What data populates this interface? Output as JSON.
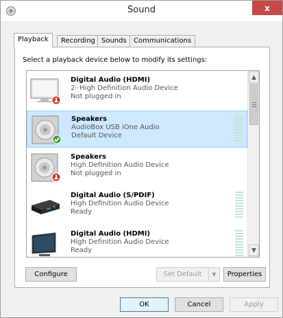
{
  "window": {
    "title": "Sound",
    "close_label": "x",
    "icon": "speaker-icon"
  },
  "tabs": [
    {
      "label": "Playback",
      "active": true
    },
    {
      "label": "Recording",
      "active": false
    },
    {
      "label": "Sounds",
      "active": false
    },
    {
      "label": "Communications",
      "active": false
    }
  ],
  "panel": {
    "instruction": "Select a playback device below to modify its settings:"
  },
  "devices": [
    {
      "name": "Digital Audio (HDMI)",
      "description": "2- High Definition Audio Device",
      "status": "Not plugged in",
      "icon": "monitor-icon",
      "badge": "unplugged-badge-icon",
      "selected": false,
      "level_meter": false
    },
    {
      "name": "Speakers",
      "description": "AudioBox USB iOne Audio",
      "status": "Default Device",
      "icon": "speaker-icon",
      "badge": "default-check-badge-icon",
      "selected": true,
      "level_meter": true
    },
    {
      "name": "Speakers",
      "description": "High Definition Audio Device",
      "status": "Not plugged in",
      "icon": "speaker-icon",
      "badge": "unplugged-badge-icon",
      "selected": false,
      "level_meter": false
    },
    {
      "name": "Digital Audio (S/PDIF)",
      "description": "High Definition Audio Device",
      "status": "Ready",
      "icon": "spdif-receiver-icon",
      "badge": "",
      "selected": false,
      "level_meter": true
    },
    {
      "name": "Digital Audio (HDMI)",
      "description": "High Definition Audio Device",
      "status": "Ready",
      "icon": "monitor-icon",
      "badge": "",
      "selected": false,
      "level_meter": true
    }
  ],
  "buttons": {
    "configure": "Configure",
    "set_default": "Set Default",
    "properties": "Properties",
    "ok": "OK",
    "cancel": "Cancel",
    "apply": "Apply"
  },
  "colors": {
    "selection": "#cde8ff",
    "close_button": "#c74646",
    "default_badge": "#3aa544",
    "unplugged_badge": "#d9342b"
  }
}
